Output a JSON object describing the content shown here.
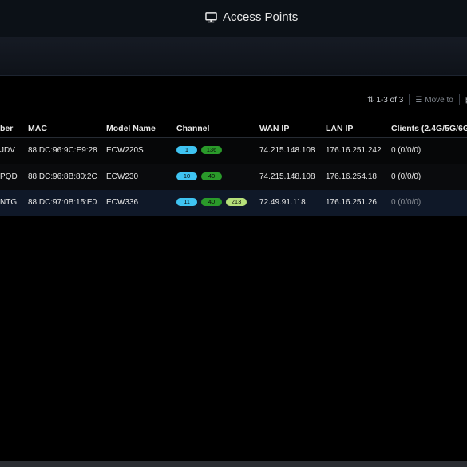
{
  "header": {
    "title": "Access Points",
    "icon": "monitor-icon"
  },
  "toolbar": {
    "count_label": "1-3 of 3",
    "move_label": "Move to"
  },
  "table": {
    "columns": [
      "ber",
      "MAC",
      "Model Name",
      "Channel",
      "WAN IP",
      "LAN IP",
      "Clients (2.4G/5G/6G"
    ],
    "rows": [
      {
        "serial": "JDV",
        "mac": "88:DC:96:9C:E9:28",
        "model": "ECW220S",
        "channels": [
          "1",
          "136"
        ],
        "wan": "74.215.148.108",
        "lan": "176.16.251.242",
        "clients": "0 (0/0/0)"
      },
      {
        "serial": "PQD",
        "mac": "88:DC:96:8B:80:2C",
        "model": "ECW230",
        "channels": [
          "10",
          "40"
        ],
        "wan": "74.215.148.108",
        "lan": "176.16.254.18",
        "clients": "0 (0/0/0)"
      },
      {
        "serial": "NTG",
        "mac": "88:DC:97:0B:15:E0",
        "model": "ECW336",
        "channels": [
          "11",
          "40",
          "213"
        ],
        "wan": "72.49.91.118",
        "lan": "176.16.251.26",
        "clients": "0 (0/0/0)"
      }
    ]
  },
  "colors": {
    "channel_24g": "#3fc4f2",
    "channel_5g": "#2a9a2a",
    "channel_6g": "#b6e07a"
  }
}
